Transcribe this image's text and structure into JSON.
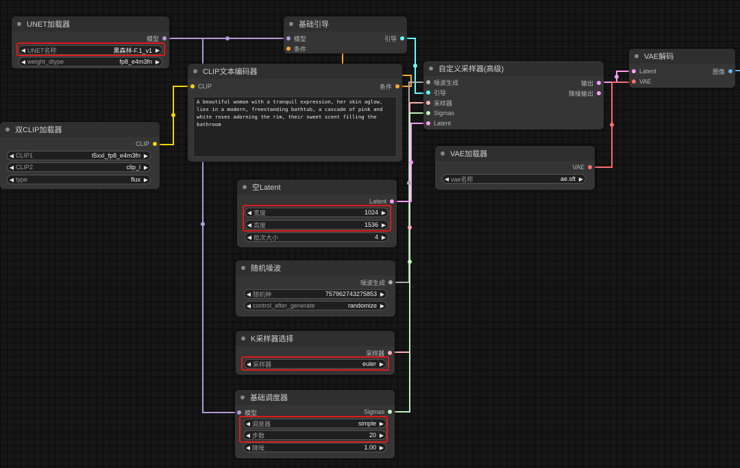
{
  "colors": {
    "model": "#b39ddb",
    "clip": "#ffd500",
    "conditioning": "#ffa931",
    "latent": "#ff9cf9",
    "noise": "#b0b0b0",
    "guider": "#66ffff",
    "sampler": "#ffb3b3",
    "sigmas": "#c5f5c0",
    "vae": "#ff6e6e",
    "image": "#64b5f6",
    "highlight": "#e01b1b"
  },
  "nodes": {
    "unet_loader": {
      "title": "UNET加载器",
      "out_model": "模型",
      "w_name_label": "UNET名称",
      "w_name_value": "黑森林-F.1_v1",
      "w_dtype_label": "weight_dtype",
      "w_dtype_value": "fp8_e4m3fn"
    },
    "dual_clip": {
      "title": "双CLIP加载器",
      "out_clip": "CLIP",
      "w_clip1_label": "CLIP1",
      "w_clip1_value": "t5xxl_fp8_e4m3fn",
      "w_clip2_label": "CLIP2",
      "w_clip2_value": "clip_l",
      "w_type_label": "type",
      "w_type_value": "flux"
    },
    "guider": {
      "title": "基础引导",
      "in_model": "模型",
      "in_cond": "条件",
      "out_guider": "引导"
    },
    "clip_text": {
      "title": "CLIP文本编码器",
      "in_clip": "CLIP",
      "out_cond": "条件",
      "prompt": "A beautiful woman with a tranquil expression, her skin aglow, lies in a modern, freestanding bathtub, a cascade of pink and white roses adorning the rim, their sweet scent filling the bathroom"
    },
    "custom_sampler": {
      "title": "自定义采样器(高级)",
      "in_noise": "噪波生成",
      "in_guider": "引导",
      "in_sampler": "采样器",
      "in_sigmas": "Sigmas",
      "in_latent": "Latent",
      "out_output": "输出",
      "out_denoised": "降噪输出"
    },
    "vae_decode": {
      "title": "VAE解码",
      "in_latent": "Latent",
      "in_vae": "VAE",
      "out_image": "图像"
    },
    "vae_loader": {
      "title": "VAE加载器",
      "out_vae": "VAE",
      "w_name_label": "vae名称",
      "w_name_value": "ae.sft"
    },
    "empty_latent": {
      "title": "空Latent",
      "out_latent": "Latent",
      "w_width_label": "宽度",
      "w_width_value": "1024",
      "w_height_label": "高度",
      "w_height_value": "1536",
      "w_batch_label": "批次大小",
      "w_batch_value": "4"
    },
    "random_noise": {
      "title": "随机噪波",
      "out_noise": "噪波生成",
      "w_seed_label": "随机种",
      "w_seed_value": "757962743275853",
      "w_cag_label": "control_after_generate",
      "w_cag_value": "randomize"
    },
    "ksampler_select": {
      "title": "K采样器选择",
      "out_sampler": "采样器",
      "w_sampler_label": "采样器",
      "w_sampler_value": "euler"
    },
    "basic_scheduler": {
      "title": "基础调度器",
      "in_model": "模型",
      "out_sigmas": "Sigmas",
      "w_scheduler_label": "调度器",
      "w_scheduler_value": "simple",
      "w_steps_label": "步数",
      "w_steps_value": "20",
      "w_denoise_label": "降噪",
      "w_denoise_value": "1.00"
    }
  },
  "icons": {
    "decrement": "left-arrow-icon",
    "increment": "right-arrow-icon"
  }
}
